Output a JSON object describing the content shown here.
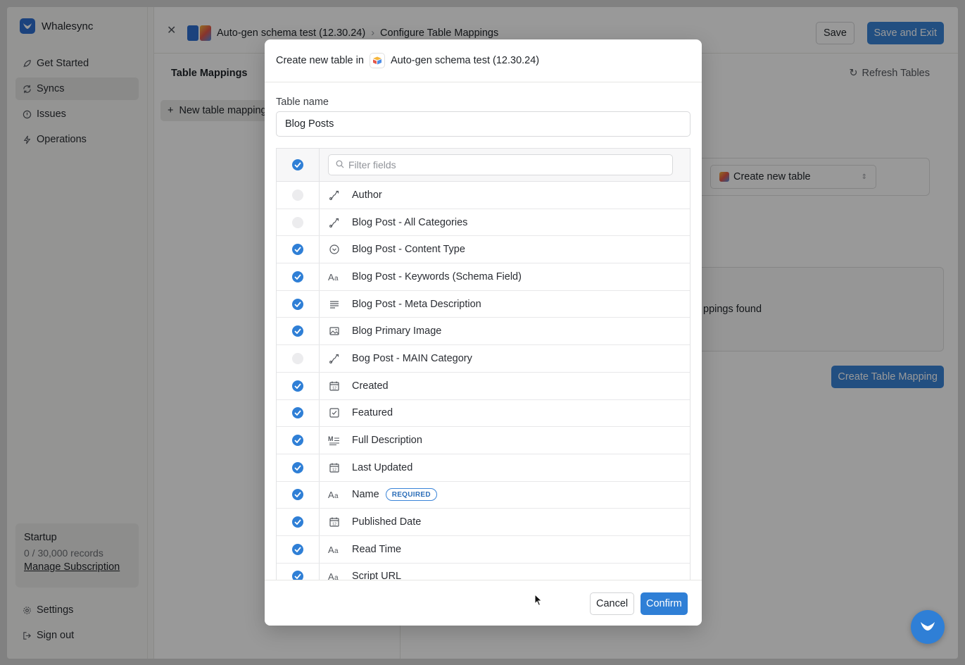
{
  "sidebar": {
    "brand": "Whalesync",
    "items": [
      {
        "label": "Get Started",
        "icon": "rocket-icon"
      },
      {
        "label": "Syncs",
        "icon": "sync-icon",
        "active": true
      },
      {
        "label": "Issues",
        "icon": "alert-circle-icon"
      },
      {
        "label": "Operations",
        "icon": "bolt-icon"
      }
    ],
    "plan": {
      "name": "Startup",
      "records": "0 / 30,000 records",
      "manage_label": "Manage Subscription"
    },
    "bottom_items": [
      {
        "label": "Settings",
        "icon": "gear-icon"
      },
      {
        "label": "Sign out",
        "icon": "sign-out-icon"
      }
    ]
  },
  "header": {
    "project_name": "Auto-gen schema test (12.30.24)",
    "page_title": "Configure Table Mappings",
    "save_label": "Save",
    "save_exit_label": "Save and Exit"
  },
  "main": {
    "panel_title": "Table Mappings",
    "new_mapping_label": "New table mapping",
    "refresh_label": "Refresh Tables",
    "select_value": "Create new table",
    "empty_text": "ppings found",
    "create_mapping_label": "Create Table Mapping"
  },
  "modal": {
    "title_prefix": "Create new table in",
    "base_name": "Auto-gen schema test (12.30.24)",
    "table_name_label": "Table name",
    "table_name_value": "Blog Posts",
    "filter_placeholder": "Filter fields",
    "select_all_checked": true,
    "fields": [
      {
        "name": "Author",
        "icon": "link-icon",
        "checked": false
      },
      {
        "name": "Blog Post - All Categories",
        "icon": "link-icon",
        "checked": false
      },
      {
        "name": "Blog Post - Content Type",
        "icon": "select-icon",
        "checked": true
      },
      {
        "name": "Blog Post - Keywords (Schema Field)",
        "icon": "text-icon",
        "checked": true
      },
      {
        "name": "Blog Post - Meta Description",
        "icon": "long-text-icon",
        "checked": true
      },
      {
        "name": "Blog Primary Image",
        "icon": "image-icon",
        "checked": true
      },
      {
        "name": "Bog Post - MAIN Category",
        "icon": "link-icon",
        "checked": false
      },
      {
        "name": "Created",
        "icon": "calendar-icon",
        "checked": true
      },
      {
        "name": "Featured",
        "icon": "checkbox-icon",
        "checked": true
      },
      {
        "name": "Full Description",
        "icon": "markdown-icon",
        "checked": true
      },
      {
        "name": "Last Updated",
        "icon": "calendar-icon",
        "checked": true
      },
      {
        "name": "Name",
        "icon": "text-icon",
        "checked": true,
        "badge": "REQUIRED"
      },
      {
        "name": "Published Date",
        "icon": "calendar-icon",
        "checked": true
      },
      {
        "name": "Read Time",
        "icon": "text-icon",
        "checked": true
      },
      {
        "name": "Script URL",
        "icon": "text-icon",
        "checked": true
      }
    ],
    "cancel_label": "Cancel",
    "confirm_label": "Confirm"
  },
  "colors": {
    "accent": "#2f7fd6",
    "brand": "#2d6fd1"
  }
}
